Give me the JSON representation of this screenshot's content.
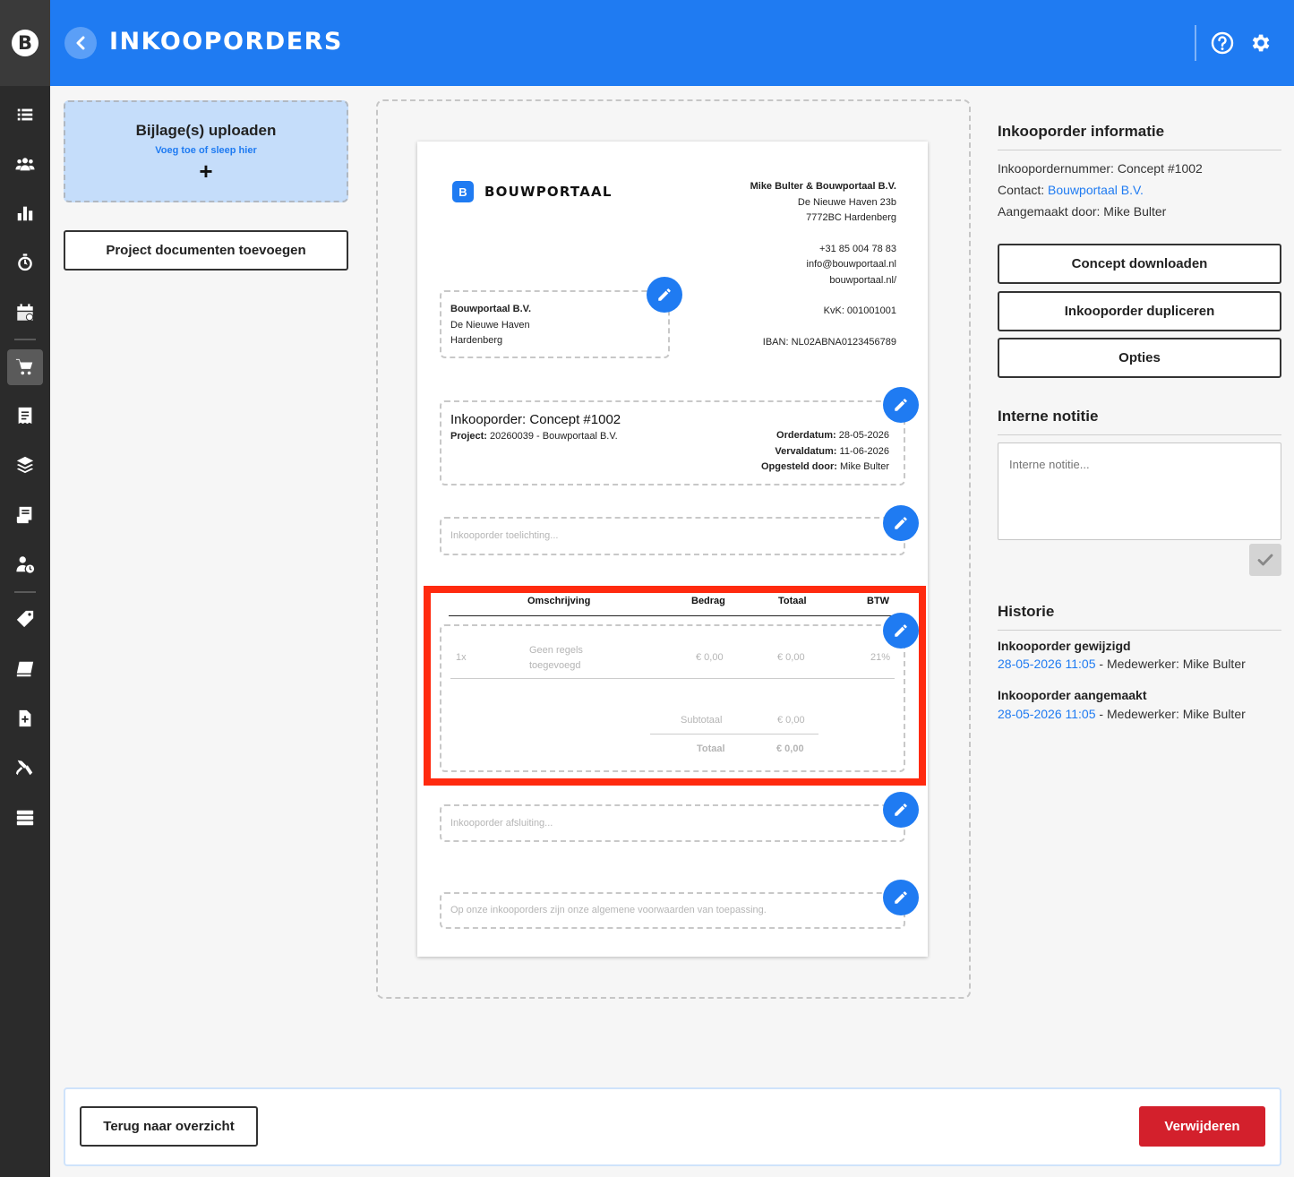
{
  "header": {
    "title": "INKOOPORDERS"
  },
  "sidebar": {
    "logo": "B",
    "items": [
      {
        "icon": "list-icon"
      },
      {
        "icon": "users-icon"
      },
      {
        "icon": "chart-icon"
      },
      {
        "icon": "stopwatch-icon"
      },
      {
        "icon": "calendar-icon"
      },
      {
        "icon": "cart-icon",
        "active": true
      },
      {
        "icon": "receipt-icon"
      },
      {
        "icon": "layers-icon"
      },
      {
        "icon": "invoice-icon"
      },
      {
        "icon": "user-clock-icon"
      },
      {
        "icon": "tag-icon"
      },
      {
        "icon": "book-icon"
      },
      {
        "icon": "file-plus-icon"
      },
      {
        "icon": "tools-icon"
      },
      {
        "icon": "server-icon"
      }
    ]
  },
  "upload": {
    "title": "Bijlage(s) uploaden",
    "subtitle": "Voeg toe of sleep hier",
    "plus": "+"
  },
  "project_docs_button": "Project documenten toevoegen",
  "document": {
    "brand_logo": "B",
    "brand_name": "BOUWPORTAAL",
    "company": {
      "name": "Mike Bulter & Bouwportaal B.V.",
      "street": "De Nieuwe Haven 23b",
      "city": "7772BC Hardenberg",
      "phone": "+31 85 004 78 83",
      "email": "info@bouwportaal.nl",
      "website": "bouwportaal.nl/",
      "kvk": "KvK: 001001001",
      "iban": "IBAN: NL02ABNA0123456789"
    },
    "recipient": {
      "name": "Bouwportaal B.V.",
      "street": "De Nieuwe Haven",
      "city": "Hardenberg"
    },
    "order": {
      "title": "Inkooporder: Concept #1002",
      "project_label": "Project:",
      "project_value": "20260039 - Bouwportaal B.V.",
      "orderdatum_label": "Orderdatum:",
      "orderdatum_value": "28-05-2026",
      "vervaldatum_label": "Vervaldatum:",
      "vervaldatum_value": "11-06-2026",
      "opgesteld_label": "Opgesteld door:",
      "opgesteld_value": "Mike Bulter"
    },
    "toelichting_placeholder": "Inkooporder toelichting...",
    "table": {
      "headers": [
        "Omschrijving",
        "Bedrag",
        "Totaal",
        "BTW"
      ],
      "row": {
        "qty": "1x",
        "desc_line1": "Geen regels",
        "desc_line2": "toegevoegd",
        "bedrag": "€ 0,00",
        "totaal": "€ 0,00",
        "btw": "21%"
      },
      "subtotal_label": "Subtotaal",
      "subtotal_value": "€ 0,00",
      "total_label": "Totaal",
      "total_value": "€ 0,00"
    },
    "afsluiting_placeholder": "Inkooporder afsluiting...",
    "voorwaarden_text": "Op onze inkooporders zijn onze algemene voorwaarden van toepassing."
  },
  "info": {
    "title": "Inkooporder informatie",
    "nummer": "Inkoopordernummer: Concept #1002",
    "contact_label": "Contact:",
    "contact_value": "Bouwportaal B.V.",
    "aangemaakt": "Aangemaakt door: Mike Bulter"
  },
  "actions": {
    "download": "Concept downloaden",
    "duplicate": "Inkooporder dupliceren",
    "options": "Opties"
  },
  "note": {
    "title": "Interne notitie",
    "placeholder": "Interne notitie..."
  },
  "history": {
    "title": "Historie",
    "entries": [
      {
        "title": "Inkooporder gewijzigd",
        "date": "28-05-2026 11:05",
        "meta": " - Medewerker: Mike Bulter"
      },
      {
        "title": "Inkooporder aangemaakt",
        "date": "28-05-2026 11:05",
        "meta": " - Medewerker: Mike Bulter"
      }
    ]
  },
  "footer": {
    "back": "Terug naar overzicht",
    "delete": "Verwijderen"
  },
  "colors": {
    "primary": "#1f7bf2",
    "danger": "#d3202c",
    "highlight": "#ff2a0f",
    "sidebar": "#2b2b2b"
  }
}
